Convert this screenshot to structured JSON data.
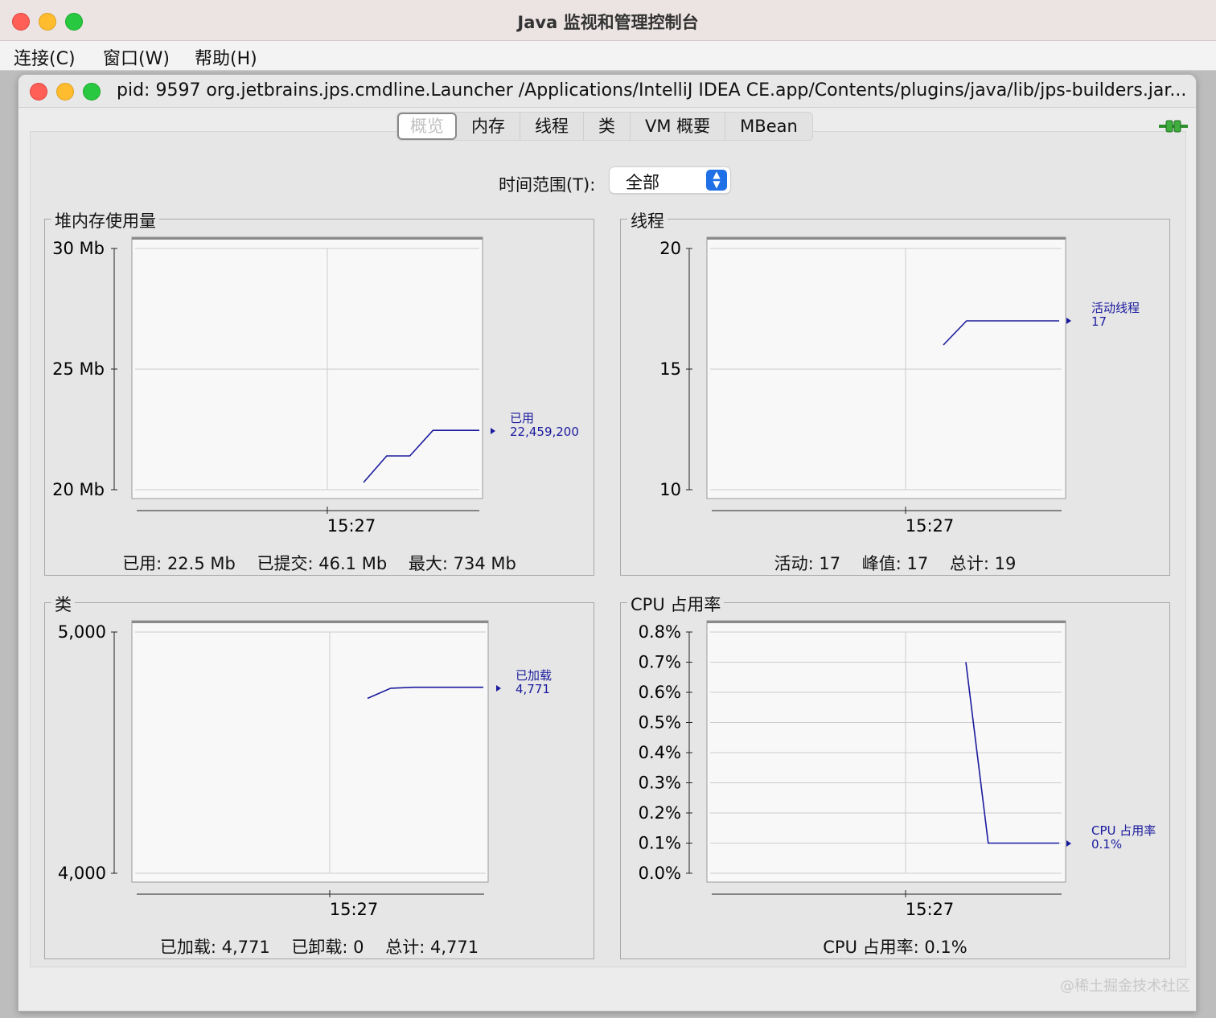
{
  "window": {
    "title": "Java 监视和管理控制台"
  },
  "menubar": {
    "items": [
      "连接(C)",
      "窗口(W)",
      "帮助(H)"
    ]
  },
  "connection_window": {
    "title": "pid: 9597 org.jetbrains.jps.cmdline.Launcher /Applications/IntelliJ IDEA CE.app/Contents/plugins/java/lib/jps-builders.jar..."
  },
  "tabs": [
    {
      "label": "概览",
      "active": true
    },
    {
      "label": "内存"
    },
    {
      "label": "线程"
    },
    {
      "label": "类"
    },
    {
      "label": "VM 概要"
    },
    {
      "label": "MBean"
    }
  ],
  "time_range": {
    "label": "时间范围(T):",
    "value": "全部"
  },
  "panels": {
    "heap": {
      "title": "堆内存使用量",
      "legend_label": "已用",
      "legend_value": "22,459,200",
      "footer": "已用: 22.5 Mb    已提交: 46.1 Mb    最大: 734 Mb"
    },
    "threads": {
      "title": "线程",
      "legend_label": "活动线程",
      "legend_value": "17",
      "footer": "活动: 17    峰值: 17    总计: 19"
    },
    "classes": {
      "title": "类",
      "legend_label": "已加载",
      "legend_value": "4,771",
      "footer": "已加载: 4,771    已卸载: 0    总计: 4,771"
    },
    "cpu": {
      "title": "CPU 占用率",
      "legend_label": "CPU 占用率",
      "legend_value": "0.1%",
      "footer": "CPU 占用率: 0.1%"
    }
  },
  "chart_data": [
    {
      "type": "line",
      "title": "堆内存使用量",
      "yticks": [
        "30 Mb",
        "25 Mb",
        "20 Mb"
      ],
      "ylim": [
        20,
        30
      ],
      "xticks": [
        "15:27"
      ],
      "series": [
        {
          "name": "已用",
          "points": [
            [
              0.0,
              20.3
            ],
            [
              0.2,
              21.4
            ],
            [
              0.4,
              21.4
            ],
            [
              0.6,
              22.46
            ],
            [
              1.0,
              22.46
            ]
          ]
        }
      ],
      "color": "#1a1a9e"
    },
    {
      "type": "line",
      "title": "线程",
      "yticks": [
        "20",
        "15",
        "10"
      ],
      "ylim": [
        10,
        20
      ],
      "xticks": [
        "15:27"
      ],
      "series": [
        {
          "name": "活动线程",
          "points": [
            [
              0.0,
              16.0
            ],
            [
              0.2,
              17.0
            ],
            [
              1.0,
              17.0
            ]
          ]
        }
      ],
      "color": "#1a1a9e"
    },
    {
      "type": "line",
      "title": "类",
      "yticks": [
        "5,000",
        "4,000"
      ],
      "ylim": [
        4000,
        5000
      ],
      "xticks": [
        "15:27"
      ],
      "series": [
        {
          "name": "已加载",
          "points": [
            [
              0.0,
              4725
            ],
            [
              0.2,
              4767
            ],
            [
              0.4,
              4771
            ],
            [
              1.0,
              4771
            ]
          ]
        }
      ],
      "color": "#1a1a9e"
    },
    {
      "type": "line",
      "title": "CPU 占用率",
      "yticks": [
        "0.8%",
        "0.7%",
        "0.6%",
        "0.5%",
        "0.4%",
        "0.3%",
        "0.2%",
        "0.1%",
        "0.0%"
      ],
      "ylim": [
        0,
        0.8
      ],
      "xticks": [
        "15:27"
      ],
      "series": [
        {
          "name": "CPU 占用率",
          "points": [
            [
              0.0,
              0.7
            ],
            [
              0.24,
              0.1
            ],
            [
              1.0,
              0.1
            ]
          ]
        }
      ],
      "color": "#1a1a9e"
    }
  ],
  "watermark": "@稀土掘金技术社区",
  "colors": {
    "line": "#1a1a9e",
    "grid": "#cccccc"
  }
}
